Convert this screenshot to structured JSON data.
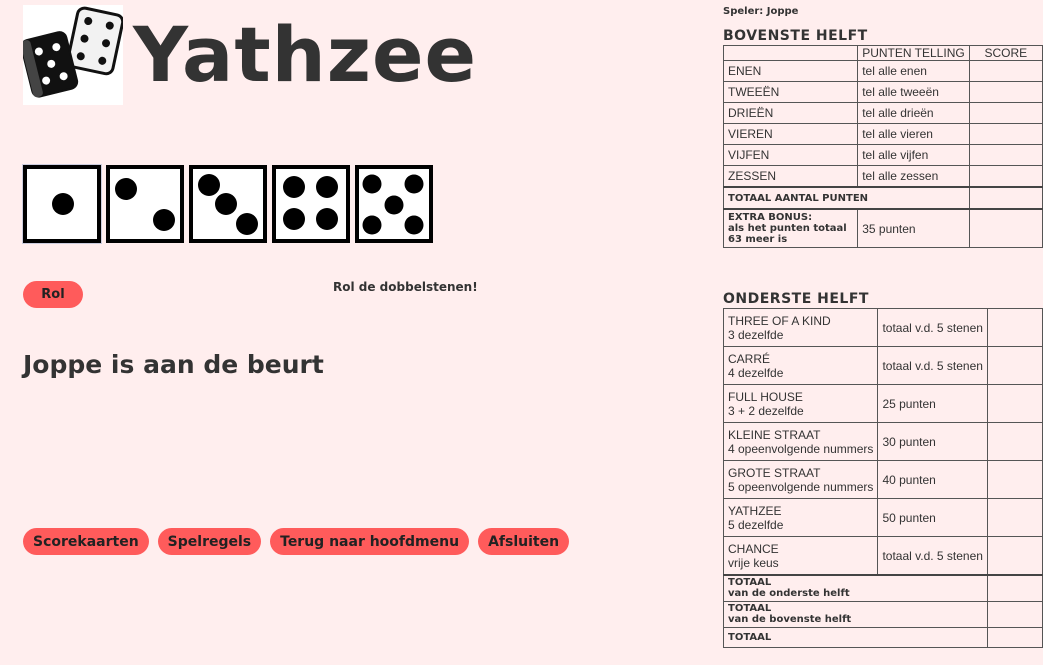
{
  "app": {
    "title": "Yathzee"
  },
  "dice": [
    1,
    2,
    3,
    4,
    5
  ],
  "controls": {
    "roll_label": "Rol",
    "roll_message": "Rol de dobbelstenen!",
    "turn_text": "Joppe is aan de beurt"
  },
  "nav": {
    "scorecards": "Scorekaarten",
    "rules": "Spelregels",
    "main_menu": "Terug naar hoofdmenu",
    "quit": "Afsluiten"
  },
  "scorecard": {
    "player_label": "Speler: Joppe",
    "upper": {
      "heading": "BOVENSTE HELFT",
      "col_points": "PUNTEN TELLING",
      "col_score": "SCORE",
      "rows": [
        {
          "name": "ENEN",
          "rule": "tel alle enen",
          "score": ""
        },
        {
          "name": "TWEEËN",
          "rule": "tel alle tweeën",
          "score": ""
        },
        {
          "name": "DRIEËN",
          "rule": "tel alle drieën",
          "score": ""
        },
        {
          "name": "VIEREN",
          "rule": "tel alle vieren",
          "score": ""
        },
        {
          "name": "VIJFEN",
          "rule": "tel alle vijfen",
          "score": ""
        },
        {
          "name": "ZESSEN",
          "rule": "tel alle zessen",
          "score": ""
        }
      ],
      "total_label": "TOTAAL AANTAL PUNTEN",
      "bonus_label": "EXTRA BONUS:",
      "bonus_desc": "als het punten totaal 63 meer is",
      "bonus_points": "35 punten"
    },
    "lower": {
      "heading": "ONDERSTE HELFT",
      "rows": [
        {
          "name": "THREE OF A KIND",
          "desc": "3 dezelfde",
          "rule": "totaal v.d. 5 stenen",
          "score": ""
        },
        {
          "name": "CARRÉ",
          "desc": "4 dezelfde",
          "rule": "totaal v.d. 5 stenen",
          "score": ""
        },
        {
          "name": "FULL HOUSE",
          "desc": "3 + 2 dezelfde",
          "rule": "25 punten",
          "score": ""
        },
        {
          "name": "KLEINE STRAAT",
          "desc": "4 opeenvolgende nummers",
          "rule": "30 punten",
          "score": ""
        },
        {
          "name": "GROTE STRAAT",
          "desc": "5 opeenvolgende nummers",
          "rule": "40 punten",
          "score": ""
        },
        {
          "name": "YATHZEE",
          "desc": "5 dezelfde",
          "rule": "50 punten",
          "score": ""
        },
        {
          "name": "CHANCE",
          "desc": "vrije keus",
          "rule": "totaal v.d. 5 stenen",
          "score": ""
        }
      ],
      "total_lower_1": "TOTAAL",
      "total_lower_2": "van de onderste helft",
      "total_upper_1": "TOTAAL",
      "total_upper_2": "van de bovenste helft",
      "grand_total": "TOTAAL"
    }
  }
}
